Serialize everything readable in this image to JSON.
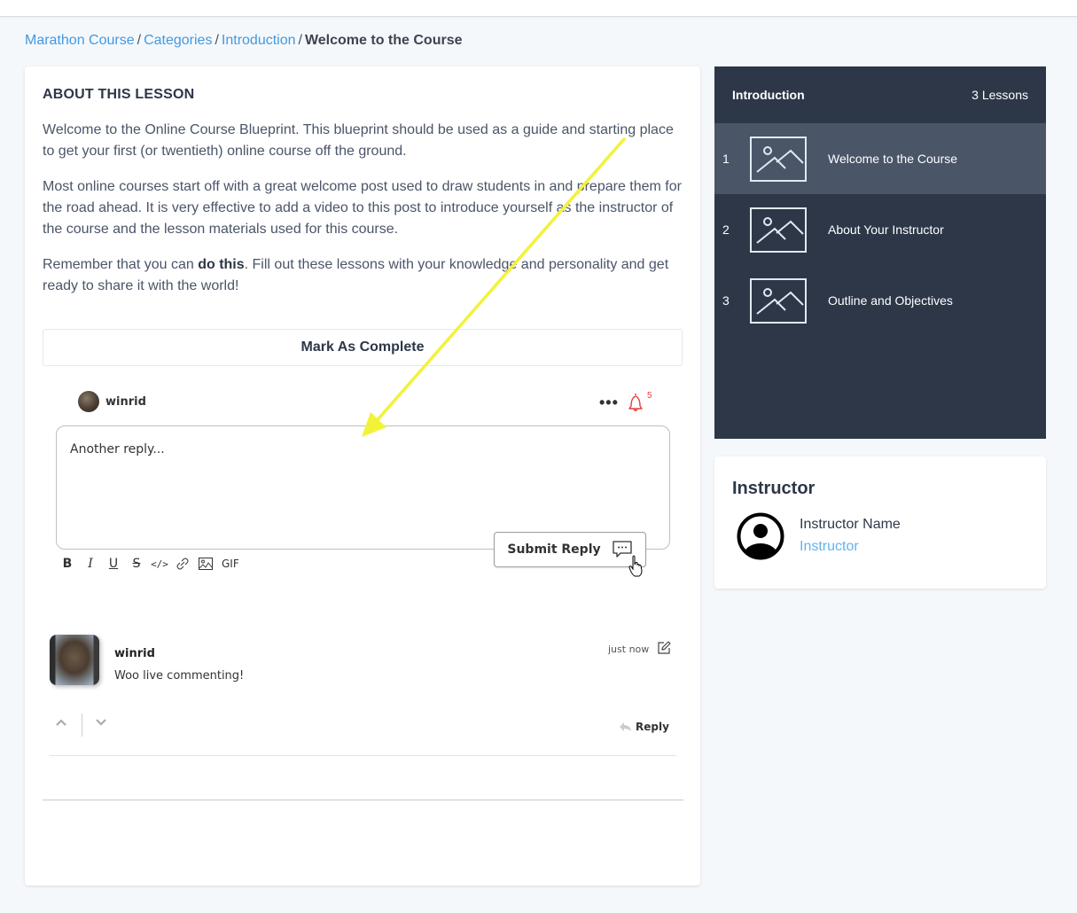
{
  "breadcrumb": {
    "items": [
      "Marathon Course",
      "Categories",
      "Introduction"
    ],
    "separator": "/",
    "current": "Welcome to the Course"
  },
  "lesson": {
    "heading": "ABOUT THIS LESSON",
    "paragraph1": "Welcome to the Online Course Blueprint. This blueprint should be used as a guide and starting place to get your first (or twentieth) online course off the ground.",
    "paragraph2": "Most online courses start off with a great welcome post used to draw students in and prepare them for the road ahead. It is very effective to add a video to this post to introduce yourself as the instructor of the course and the lesson materials used for this course.",
    "paragraph3_before": "Remember that you can ",
    "paragraph3_bold": "do this",
    "paragraph3_after": ". Fill out these lessons with your knowledge and personality and get ready to share it with the world!",
    "complete_button": "Mark As Complete"
  },
  "composer": {
    "username": "winrid",
    "more_icon": "ellipsis-icon",
    "notification_icon": "bell-icon",
    "notification_count": "5",
    "reply_text": "Another reply...",
    "submit_label": "Submit Reply",
    "toolbar": {
      "bold": "B",
      "italic": "I",
      "underline": "U",
      "strike": "S",
      "code": "</>",
      "link_icon": "link-icon",
      "image_icon": "image-icon",
      "gif": "GIF"
    },
    "accent_color": "#e53e3e"
  },
  "comments": [
    {
      "username": "winrid",
      "text": "Woo live commenting!",
      "time": "just now",
      "reply_label": "Reply"
    }
  ],
  "lesson_panel": {
    "title": "Introduction",
    "count": "3 Lessons",
    "items": [
      {
        "num": "1",
        "title": "Welcome to the Course",
        "active": true
      },
      {
        "num": "2",
        "title": "About Your Instructor",
        "active": false
      },
      {
        "num": "3",
        "title": "Outline and Objectives",
        "active": false
      }
    ],
    "bg_color": "#2d3748",
    "active_color": "#4a5568"
  },
  "instructor": {
    "heading": "Instructor",
    "name": "Instructor Name",
    "role": "Instructor"
  },
  "annotation": {
    "type": "arrow",
    "color": "#f2f23a"
  }
}
